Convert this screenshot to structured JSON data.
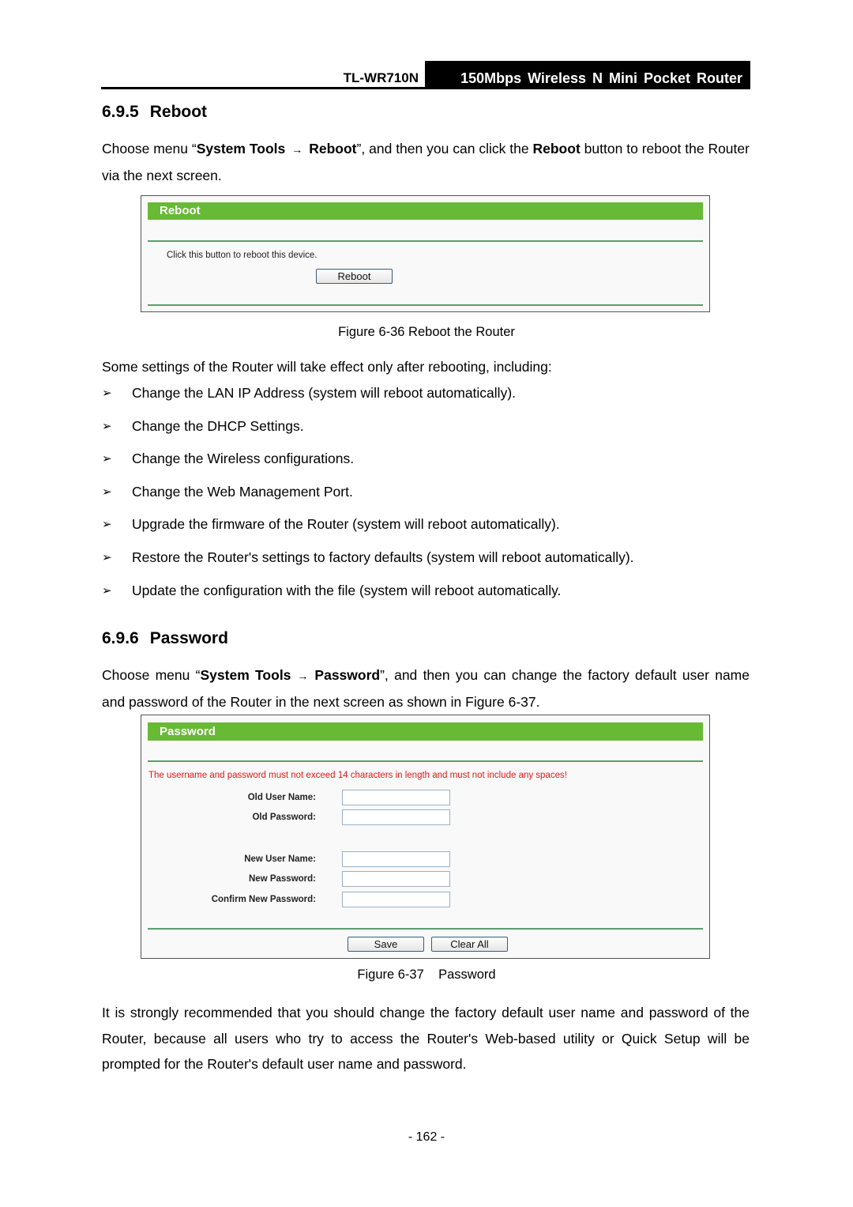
{
  "header": {
    "model": "TL-WR710N",
    "product": "150Mbps Wireless N Mini Pocket Router"
  },
  "section_reboot": {
    "number": "6.9.5",
    "title": "Reboot",
    "intro_pre": "Choose menu “",
    "menu_path_1": "System Tools",
    "arrow": "→",
    "menu_path_2": "Reboot",
    "intro_mid": "”, and then you can click the ",
    "intro_bold": "Reboot",
    "intro_post": " button to reboot the Router via the next screen.",
    "figure": {
      "title_bar": "Reboot",
      "instruction": "Click this button to reboot this device.",
      "reboot_button": "Reboot"
    },
    "caption": "Figure 6-36 Reboot the Router",
    "settings_intro": "Some settings of the Router will take effect only after rebooting, including:",
    "bullet_marker": "➢",
    "bullets": [
      "Change the LAN IP Address (system will reboot automatically).",
      "Change the DHCP Settings.",
      "Change the Wireless configurations.",
      "Change the Web Management Port.",
      "Upgrade the firmware of the Router (system will reboot automatically).",
      "Restore the Router's settings to factory defaults (system will reboot automatically).",
      "Update the configuration with the file (system will reboot automatically."
    ]
  },
  "section_password": {
    "number": "6.9.6",
    "title": "Password",
    "intro_pre": "Choose menu “",
    "menu_path_1": "System Tools",
    "arrow": "→",
    "menu_path_2": "Password",
    "intro_post": "”, and then you can change the factory default user name and password of the Router in the next screen as shown in Figure 6-37.",
    "figure": {
      "title_bar": "Password",
      "warning": "The username and password must not exceed 14 characters in length and must not include any spaces!",
      "fields": [
        {
          "label": "Old User Name:",
          "value": ""
        },
        {
          "label": "Old Password:",
          "value": ""
        },
        {
          "label": "New User Name:",
          "value": ""
        },
        {
          "label": "New Password:",
          "value": ""
        },
        {
          "label": "Confirm New Password:",
          "value": ""
        }
      ],
      "save_button": "Save",
      "clear_button": "Clear All"
    },
    "caption": "Figure 6-37    Password",
    "recommendation": "It is strongly recommended that you should change the factory default user name and password of the Router, because all users who try to access the Router's Web-based utility or Quick Setup will be prompted for the Router's default user name and password."
  },
  "page_number": "- 162 -"
}
